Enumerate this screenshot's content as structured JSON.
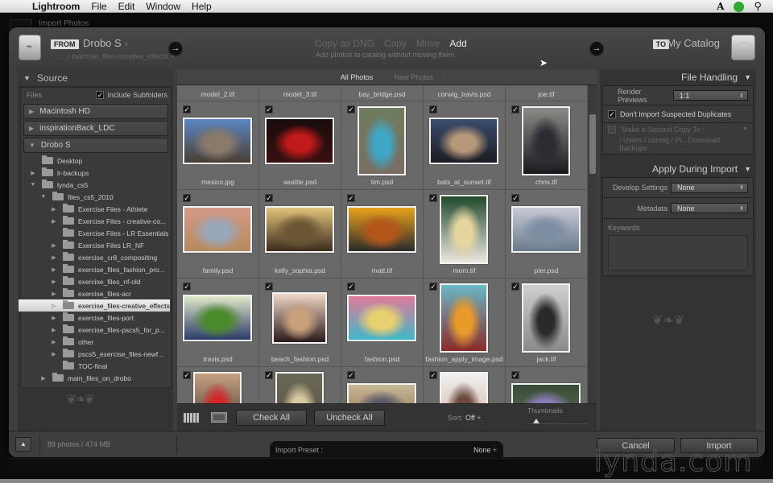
{
  "menubar": {
    "apple": "",
    "app": "Lightroom",
    "items": [
      "File",
      "Edit",
      "Window",
      "Help"
    ],
    "right_icons": [
      "adobe-icon",
      "status-green-icon",
      "spotlight-search-icon"
    ]
  },
  "background_window": {
    "title": "Import Photos"
  },
  "header": {
    "from_tag": "FROM",
    "source_name": "Drobo S",
    "source_path": "…/ exercise_files-creative_effects +",
    "modes": [
      {
        "label": "Copy as DNG",
        "active": false
      },
      {
        "label": "Copy",
        "active": false
      },
      {
        "label": "Move",
        "active": false
      },
      {
        "label": "Add",
        "active": true
      }
    ],
    "mode_description": "Add photos to catalog without moving them",
    "to_tag": "TO",
    "destination": "My Catalog",
    "arrow": "→"
  },
  "source_panel": {
    "title": "Source",
    "files_label": "Files",
    "include_subfolders": {
      "label": "Include Subfolders",
      "checked": true
    },
    "volumes": [
      {
        "name": "Macintosh HD",
        "expanded": false
      },
      {
        "name": "inspirationBack_LDC",
        "expanded": false
      },
      {
        "name": "Drobo S",
        "expanded": true
      }
    ],
    "tree": [
      {
        "name": "Desktop",
        "level": 1,
        "twisty": ""
      },
      {
        "name": "lr-backups",
        "level": 1,
        "twisty": "▶"
      },
      {
        "name": "lynda_cs5",
        "level": 1,
        "twisty": "▼"
      },
      {
        "name": "files_cs5_2010",
        "level": 2,
        "twisty": "▼"
      },
      {
        "name": "Exercise Files - Athlete",
        "level": 3,
        "twisty": "▶"
      },
      {
        "name": "Exercise Files - creative-co...",
        "level": 3,
        "twisty": "▶"
      },
      {
        "name": "Exercise Files - LR Essentials",
        "level": 3,
        "twisty": ""
      },
      {
        "name": "Exercise Files LR_NF",
        "level": 3,
        "twisty": "▶"
      },
      {
        "name": "exercise_cr8_compositing",
        "level": 3,
        "twisty": "▶"
      },
      {
        "name": "exercise_files_fashion_pro...",
        "level": 3,
        "twisty": "▶"
      },
      {
        "name": "exercise_files_nf-old",
        "level": 3,
        "twisty": "▶"
      },
      {
        "name": "exercise_files-acr",
        "level": 3,
        "twisty": "▶"
      },
      {
        "name": "exercise_files-creative_effects",
        "level": 3,
        "twisty": "▷",
        "selected": true
      },
      {
        "name": "exercise_files-port",
        "level": 3,
        "twisty": "▶"
      },
      {
        "name": "exercise_files-pscs5_for_p...",
        "level": 3,
        "twisty": "▶"
      },
      {
        "name": "other",
        "level": 3,
        "twisty": "▶"
      },
      {
        "name": "pscs5_exercise_files-newf...",
        "level": 3,
        "twisty": "▶"
      },
      {
        "name": "TOC-final",
        "level": 3,
        "twisty": ""
      },
      {
        "name": "main_files_on_drobo",
        "level": 2,
        "twisty": "▶"
      }
    ]
  },
  "filter_tabs": [
    {
      "label": "All Photos",
      "active": true
    },
    {
      "label": "New Photos",
      "active": false
    }
  ],
  "grid": {
    "top_row": [
      "model_2.tif",
      "model_3.tif",
      "bay_bridge.psd",
      "corwig_travis.psd",
      "joe.tif"
    ],
    "rows": [
      [
        {
          "name": "mexico.jpg",
          "orient": "landscape",
          "colors": [
            "#5b87c2",
            "#8a7a6a",
            "#4a3e32"
          ]
        },
        {
          "name": "seattle.psd",
          "orient": "landscape",
          "colors": [
            "#1a0b0b",
            "#c21a1a",
            "#3a1010"
          ]
        },
        {
          "name": "tim.psd",
          "orient": "portrait",
          "colors": [
            "#6e7c5e",
            "#3fa6c7",
            "#7a6e62"
          ]
        },
        {
          "name": "bats_at_sunset.tif",
          "orient": "landscape",
          "colors": [
            "#3b4d6e",
            "#b7977a",
            "#1b1b22"
          ]
        },
        {
          "name": "chris.tif",
          "orient": "portrait",
          "colors": [
            "#8a8a86",
            "#2b2d33",
            "#1a1a1e"
          ]
        }
      ],
      [
        {
          "name": "family.psd",
          "orient": "landscape",
          "colors": [
            "#d49a88",
            "#9aa7b8",
            "#b58a5e"
          ]
        },
        {
          "name": "kelly_sophia.psd",
          "orient": "landscape",
          "colors": [
            "#e1c27a",
            "#6a5633",
            "#3b2c1e"
          ]
        },
        {
          "name": "matt.tif",
          "orient": "landscape",
          "colors": [
            "#e8a21c",
            "#b4561a",
            "#2b2b2b"
          ]
        },
        {
          "name": "mom.tif",
          "orient": "portrait",
          "colors": [
            "#1f4a2a",
            "#e7d5a0",
            "#ece7e2"
          ]
        },
        {
          "name": "pier.psd",
          "orient": "landscape",
          "colors": [
            "#c6cad6",
            "#7d8ea3",
            "#6a7a8c"
          ]
        }
      ],
      [
        {
          "name": "travis.psd",
          "orient": "landscape",
          "colors": [
            "#dfe8c8",
            "#4a8a2a",
            "#2a3a6a"
          ]
        },
        {
          "name": "beach_fashion.psd",
          "orient": "portrait-sq",
          "colors": [
            "#f0d8c8",
            "#c8a07a",
            "#2a1a1a"
          ]
        },
        {
          "name": "fashion.psd",
          "orient": "landscape",
          "colors": [
            "#e07a9a",
            "#e8d070",
            "#40b8c8"
          ]
        },
        {
          "name": "fashion_apply_image.psd",
          "orient": "portrait",
          "colors": [
            "#6ab8c8",
            "#e89a2a",
            "#8a2a2a"
          ]
        },
        {
          "name": "jack.tif",
          "orient": "portrait",
          "colors": [
            "#cfcfcf",
            "#2a2a2a",
            "#8a8a8a"
          ]
        }
      ],
      [
        {
          "name": "",
          "orient": "portrait",
          "colors": [
            "#c8a080",
            "#d02828",
            "#2a2a2a"
          ]
        },
        {
          "name": "",
          "orient": "portrait",
          "colors": [
            "#6a6a5a",
            "#d8c8a0",
            "#5a4a3a"
          ]
        },
        {
          "name": "",
          "orient": "landscape",
          "colors": [
            "#c8b898",
            "#5a5a6a",
            "#8a6a4a"
          ]
        },
        {
          "name": "",
          "orient": "portrait",
          "colors": [
            "#f2f0ee",
            "#6a4a3a",
            "#c8a898"
          ]
        },
        {
          "name": "",
          "orient": "landscape",
          "colors": [
            "#3a4a3a",
            "#8a7ab8",
            "#5a7a4a"
          ]
        }
      ]
    ]
  },
  "grid_toolbar": {
    "grid_view_icon": "grid-view-icon",
    "loupe_view_icon": "loupe-view-icon",
    "check_all": "Check All",
    "uncheck_all": "Uncheck All",
    "sort_label": "Sort:",
    "sort_value": "Off ÷",
    "thumbnails_label": "Thumbnails",
    "thumbnail_size": 0.15
  },
  "file_handling": {
    "title": "File Handling",
    "render_previews_label": "Render Previews",
    "render_previews_value": "1:1",
    "dont_import_duplicates": {
      "label": "Don't Import Suspected Duplicates",
      "checked": true
    },
    "second_copy": {
      "label": "Make a Second Copy To :",
      "checked": false
    },
    "second_copy_path": "/ Users / corwig / Pi...Download Backups"
  },
  "apply_during_import": {
    "title": "Apply During Import",
    "develop_settings_label": "Develop Settings",
    "develop_settings_value": "None",
    "metadata_label": "Metadata",
    "metadata_value": "None",
    "keywords_label": "Keywords",
    "keywords_value": ""
  },
  "bottom": {
    "count": "89 photos / 474 MB",
    "import_preset_label": "Import Preset :",
    "import_preset_value": "None ÷",
    "cancel": "Cancel",
    "import": "Import"
  },
  "watermark": "lynda.com"
}
